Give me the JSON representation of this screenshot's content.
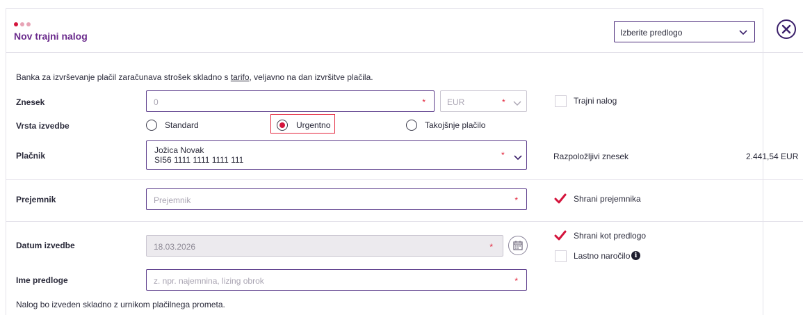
{
  "header": {
    "title": "Nov trajni nalog",
    "dot_colors": [
      "#d4143c",
      "#e7a3b5",
      "#e7a3b5"
    ],
    "template_select": {
      "value": "Izberite predlogo"
    }
  },
  "info_text": {
    "before": "Banka za izvrševanje plačil zaračunava strošek skladno s ",
    "link": "tarifo",
    "after": ", veljavno na dan izvršitve plačila."
  },
  "amount": {
    "label": "Znesek",
    "placeholder": "0",
    "currency": "EUR",
    "required_mark": "*"
  },
  "standing_order": {
    "label": "Trajni nalog",
    "checked": false
  },
  "execution_type": {
    "label": "Vrsta izvedbe",
    "options": [
      "Standard",
      "Urgentno",
      "Takojšnje plačilo"
    ],
    "selected": "Urgentno"
  },
  "payer": {
    "label": "Plačnik",
    "name": "Jožica Novak",
    "iban": "SI56 1111 1111 1111 111",
    "available_label": "Razpoložljivi znesek",
    "available_amount": "2.441,54 EUR"
  },
  "recipient": {
    "label": "Prejemnik",
    "placeholder": "Prejemnik",
    "save_label": "Shrani prejemnika",
    "save_checked": true
  },
  "execution_date": {
    "label": "Datum izvedbe",
    "value": "18.03.2026",
    "save_template_label": "Shrani kot predlogo",
    "save_template_checked": true,
    "own_order_label": "Lastno naročilo",
    "own_order_checked": false
  },
  "template_name": {
    "label": "Ime predloge",
    "placeholder": "z. npr. najemnina, lizing obrok"
  },
  "footer_note": "Nalog bo izveden skladno z urnikom plačilnega prometa.",
  "colors": {
    "accent": "#6a2a8c",
    "required": "#e3243b",
    "check": "#d4143c",
    "border": "#5a3a8a"
  }
}
